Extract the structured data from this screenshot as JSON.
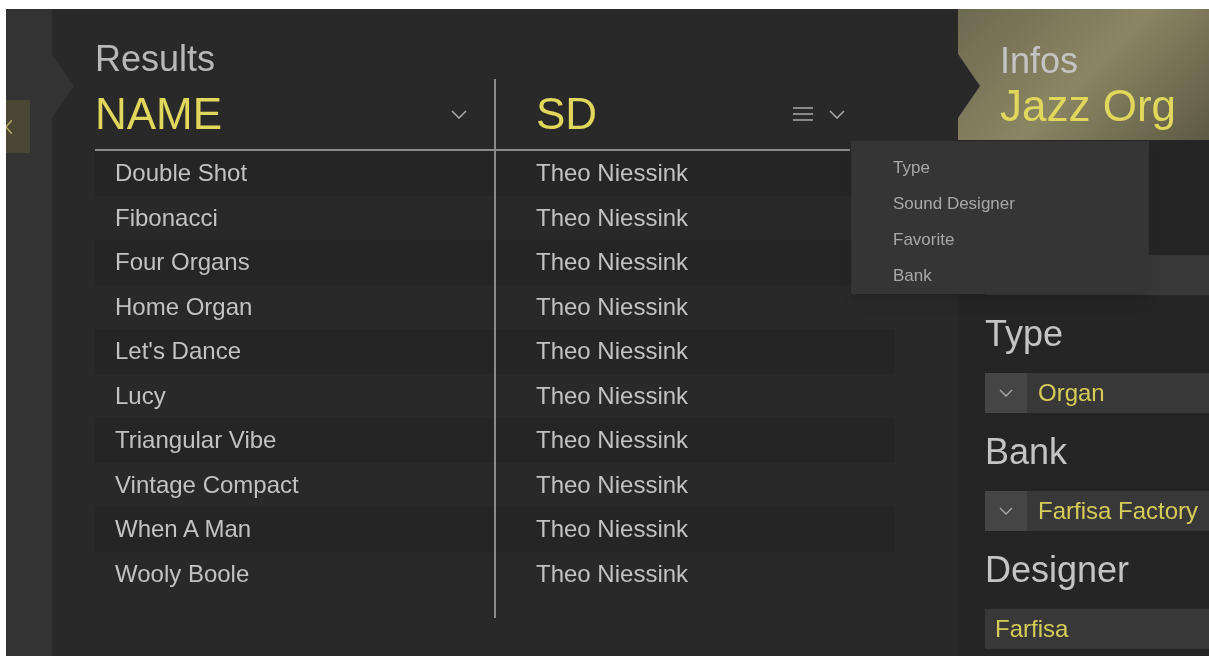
{
  "results": {
    "title": "Results",
    "columns": [
      {
        "label": "NAME"
      },
      {
        "label": "SD"
      }
    ],
    "rows": [
      {
        "name": "Double Shot",
        "sd": "Theo Niessink"
      },
      {
        "name": "Fibonacci",
        "sd": "Theo Niessink"
      },
      {
        "name": "Four Organs",
        "sd": "Theo Niessink"
      },
      {
        "name": "Home Organ",
        "sd": "Theo Niessink"
      },
      {
        "name": "Let's Dance",
        "sd": "Theo Niessink"
      },
      {
        "name": "Lucy",
        "sd": "Theo Niessink"
      },
      {
        "name": "Triangular Vibe",
        "sd": "Theo Niessink"
      },
      {
        "name": "Vintage Compact",
        "sd": "Theo Niessink"
      },
      {
        "name": "When A Man",
        "sd": "Theo Niessink"
      },
      {
        "name": "Wooly Boole",
        "sd": "Theo Niessink"
      }
    ],
    "column_menu": [
      {
        "label": "Type"
      },
      {
        "label": "Sound Designer"
      },
      {
        "label": "Favorite"
      },
      {
        "label": "Bank"
      }
    ]
  },
  "infos": {
    "title": "Infos",
    "preset_name": "Jazz Org",
    "fields": [
      {
        "label": "Type",
        "kind": "dropdown",
        "value": "Organ"
      },
      {
        "label": "Bank",
        "kind": "dropdown",
        "value": "Farfisa Factory"
      },
      {
        "label": "Designer",
        "kind": "text",
        "value": "Farfisa"
      }
    ]
  }
}
